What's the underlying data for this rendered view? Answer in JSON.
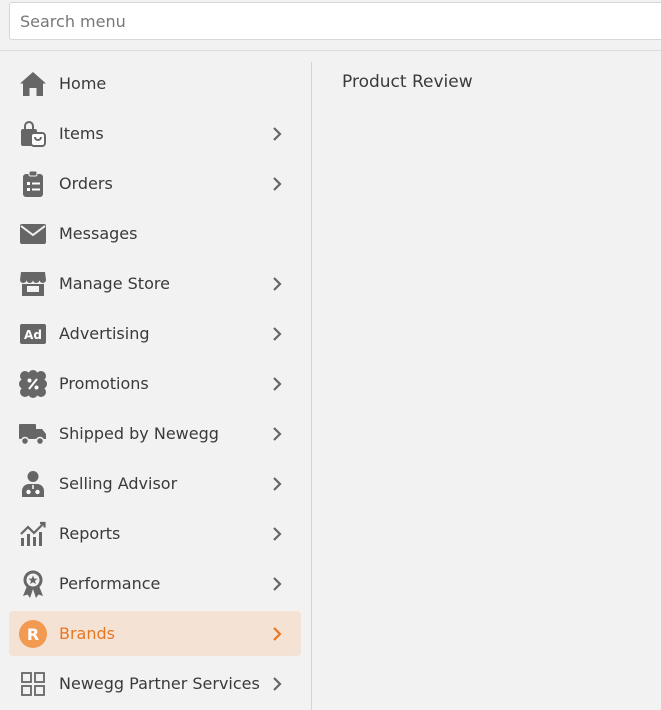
{
  "search": {
    "placeholder": "Search menu"
  },
  "sidebar": {
    "items": [
      {
        "label": "Home",
        "icon": "home-icon",
        "has_chevron": false
      },
      {
        "label": "Items",
        "icon": "shopping-bag-icon",
        "has_chevron": true
      },
      {
        "label": "Orders",
        "icon": "clipboard-list-icon",
        "has_chevron": true
      },
      {
        "label": "Messages",
        "icon": "envelope-icon",
        "has_chevron": false
      },
      {
        "label": "Manage Store",
        "icon": "storefront-icon",
        "has_chevron": true
      },
      {
        "label": "Advertising",
        "icon": "ad-icon",
        "has_chevron": true
      },
      {
        "label": "Promotions",
        "icon": "percent-badge-icon",
        "has_chevron": true
      },
      {
        "label": "Shipped by Newegg",
        "icon": "truck-icon",
        "has_chevron": true
      },
      {
        "label": "Selling Advisor",
        "icon": "advisor-icon",
        "has_chevron": true
      },
      {
        "label": "Reports",
        "icon": "chart-icon",
        "has_chevron": true
      },
      {
        "label": "Performance",
        "icon": "award-ribbon-icon",
        "has_chevron": true
      },
      {
        "label": "Brands",
        "icon": "brand-badge-icon",
        "badge_letter": "R",
        "has_chevron": true,
        "active": true
      },
      {
        "label": "Newegg Partner Services",
        "icon": "grid-icon",
        "has_chevron": true
      }
    ]
  },
  "main": {
    "title": "Product Review"
  },
  "colors": {
    "accent": "#e87722",
    "active_bg": "#f4e2d5",
    "icon": "#666666",
    "background": "#f2f2f2"
  }
}
